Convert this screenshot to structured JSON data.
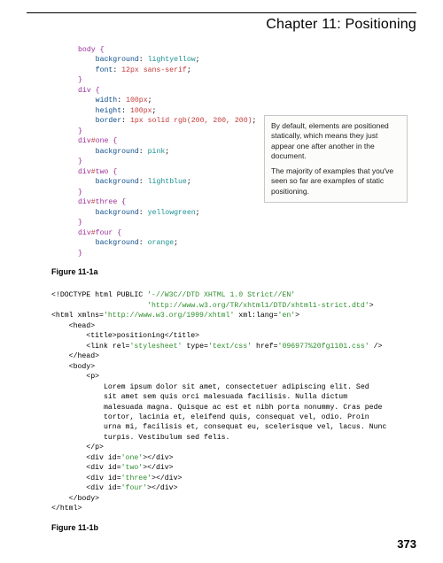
{
  "chapter_title": "Chapter 11: Positioning",
  "css_code": {
    "body_sel": "body {",
    "body_bg_prop": "    background",
    "body_bg_val": "lightyellow",
    "body_font_prop": "    font",
    "body_font_val": "12px sans-serif",
    "close": "}",
    "div_sel": "div {",
    "div_w_prop": "    width",
    "div_w_val": "100px",
    "div_h_prop": "    height",
    "div_h_val": "100px",
    "div_bd_prop": "    border",
    "div_bd_val": "1px solid rgb(200, 200, 200)",
    "one_sel_a": "div",
    "one_sel_b": "#",
    "one_sel_c": "one {",
    "one_bg_prop": "    background",
    "one_bg_val": "pink",
    "two_sel_c": "two {",
    "two_bg_val": "lightblue",
    "three_sel_c": "three {",
    "three_bg_val": "yellowgreen",
    "four_sel_c": "four {",
    "four_bg_val": "orange"
  },
  "callout": {
    "p1": "By default, elements are positioned statically, which means they just appear one after another in the document.",
    "p2": "The majority of examples that you've seen so far are examples of static positioning."
  },
  "fig1a": "Figure 11-1a",
  "html_code": {
    "l1a": "<!DOCTYPE html PUBLIC ",
    "l1b": "'-//W3C//DTD XHTML 1.0 Strict//EN'",
    "l2": "'http://www.w3.org/TR/xhtml1/DTD/xhtml1-strict.dtd'",
    "l3a": "<html xmlns=",
    "l3b": "'http://www.w3.org/1999/xhtml'",
    "l3c": " xml:lang=",
    "l3d": "'en'",
    "l3e": ">",
    "l4": "    <head>",
    "l5": "        <title>positioning</title>",
    "l6a": "        <link rel=",
    "l6b": "'stylesheet'",
    "l6c": " type=",
    "l6d": "'text/css'",
    "l6e": " href=",
    "l6f": "'096977%20fg1101.css'",
    "l6g": " />",
    "l7": "    </head>",
    "l8": "    <body>",
    "l9": "        <p>",
    "l10": "            Lorem ipsum dolor sit amet, consectetuer adipiscing elit. Sed",
    "l11": "            sit amet sem quis orci malesuada facilisis. Nulla dictum",
    "l12": "            malesuada magna. Quisque ac est et nibh porta nonummy. Cras pede",
    "l13": "            tortor, lacinia et, eleifend quis, consequat vel, odio. Proin",
    "l14": "            urna mi, facilisis et, consequat eu, scelerisque vel, lacus. Nunc",
    "l15": "            turpis. Vestibulum sed felis.",
    "l16": "        </p>",
    "l17a": "        <div id=",
    "l17b": "'one'",
    "l17c": "></div>",
    "l18b": "'two'",
    "l19b": "'three'",
    "l20b": "'four'",
    "l21": "    </body>",
    "l22": "</html>"
  },
  "fig1b": "Figure 11-1b",
  "page_num": "373"
}
